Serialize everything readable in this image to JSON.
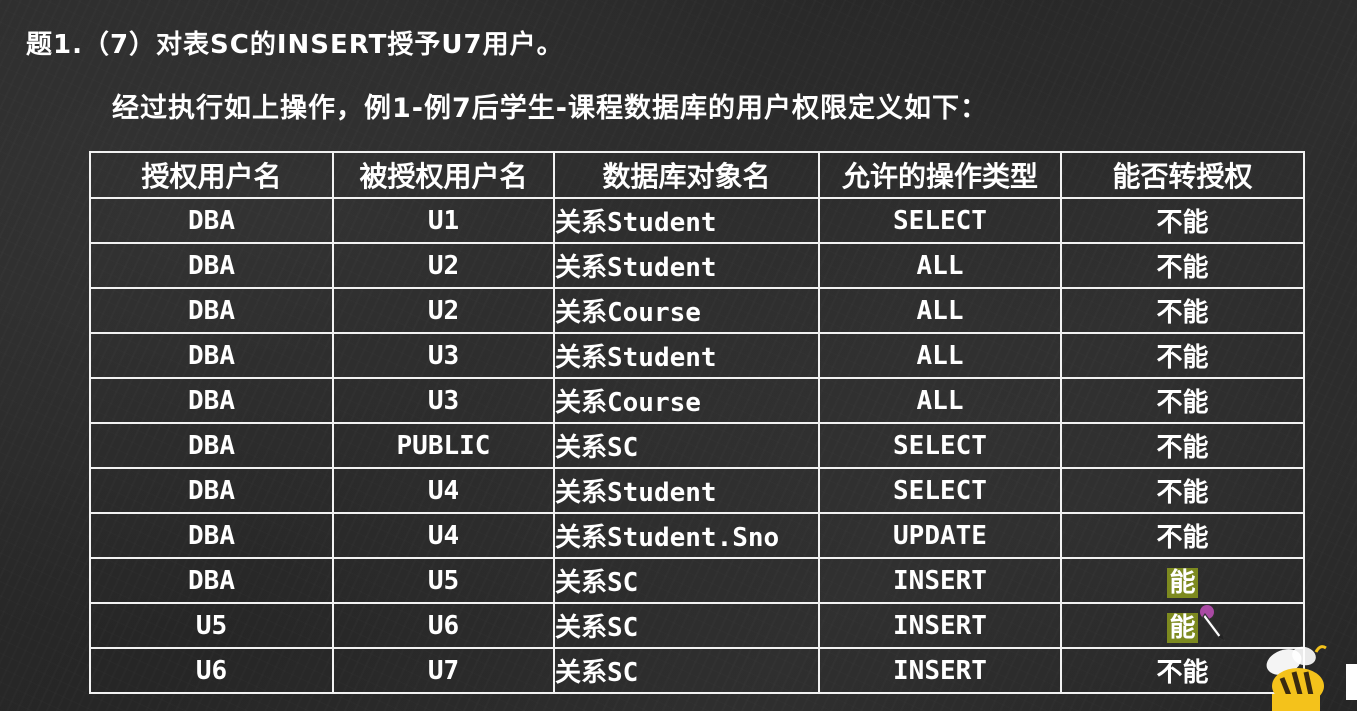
{
  "slide": {
    "title": "题1.（7）对表SC的INSERT授予U7用户。",
    "subtitle": "经过执行如上操作，例1-例7后学生-课程数据库的用户权限定义如下："
  },
  "table": {
    "headers": [
      "授权用户名",
      "被授权用户名",
      "数据库对象名",
      "允许的操作类型",
      "能否转授权"
    ],
    "rows": [
      {
        "grantor": "DBA",
        "grantee": "U1",
        "object": "关系Student",
        "operation": "SELECT",
        "transfer": "不能",
        "highlight": false
      },
      {
        "grantor": "DBA",
        "grantee": "U2",
        "object": "关系Student",
        "operation": "ALL",
        "transfer": "不能",
        "highlight": false
      },
      {
        "grantor": "DBA",
        "grantee": "U2",
        "object": "关系Course",
        "operation": "ALL",
        "transfer": "不能",
        "highlight": false
      },
      {
        "grantor": "DBA",
        "grantee": "U3",
        "object": "关系Student",
        "operation": "ALL",
        "transfer": "不能",
        "highlight": false
      },
      {
        "grantor": "DBA",
        "grantee": "U3",
        "object": "关系Course",
        "operation": "ALL",
        "transfer": "不能",
        "highlight": false
      },
      {
        "grantor": "DBA",
        "grantee": "PUBLIC",
        "object": "关系SC",
        "operation": "SELECT",
        "transfer": "不能",
        "highlight": false
      },
      {
        "grantor": "DBA",
        "grantee": "U4",
        "object": "关系Student",
        "operation": "SELECT",
        "transfer": "不能",
        "highlight": false
      },
      {
        "grantor": "DBA",
        "grantee": "U4",
        "object": "关系Student.Sno",
        "operation": "UPDATE",
        "transfer": "不能",
        "highlight": false
      },
      {
        "grantor": "DBA",
        "grantee": "U5",
        "object": "关系SC",
        "operation": "INSERT",
        "transfer": "能",
        "highlight": true
      },
      {
        "grantor": "U5",
        "grantee": "U6",
        "object": "关系SC",
        "operation": "INSERT",
        "transfer": "能",
        "highlight": true
      },
      {
        "grantor": "U6",
        "grantee": "U7",
        "object": "关系SC",
        "operation": "INSERT",
        "transfer": "不能",
        "highlight": false
      }
    ]
  },
  "colors": {
    "background": "#262626",
    "text": "#ffffff",
    "grid": "#f2f2f2",
    "highlight": "#7d8a1f"
  },
  "icons": {
    "pen_cursor": "pen-cursor-icon",
    "mascot": "bee-mascot-icon"
  }
}
